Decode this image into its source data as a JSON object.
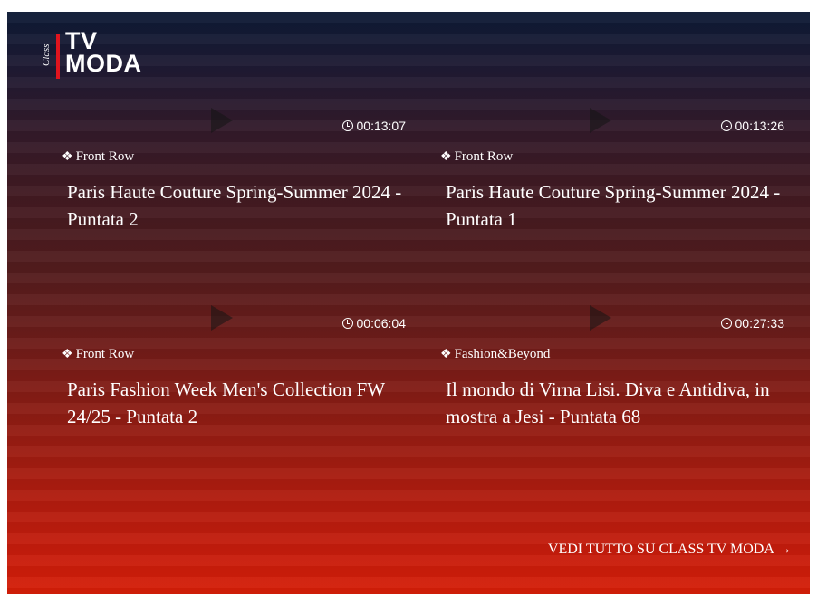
{
  "logo": {
    "class_text": "Class",
    "line1": "TV",
    "line2": "MODA"
  },
  "cards": [
    {
      "duration": "00:13:07",
      "category": "Front Row",
      "title": "Paris Haute Couture Spring-Summer 2024 - Puntata 2"
    },
    {
      "duration": "00:13:26",
      "category": "Front Row",
      "title": "Paris Haute Couture Spring-Summer 2024 - Puntata 1"
    },
    {
      "duration": "00:06:04",
      "category": "Front Row",
      "title": "Paris Fashion Week Men's Collection FW 24/25 - Puntata 2"
    },
    {
      "duration": "00:27:33",
      "category": "Fashion&Beyond",
      "title": "Il mondo di Virna Lisi. Diva e Antidiva, in mostra a Jesi - Puntata 68"
    }
  ],
  "footer": {
    "see_all": "VEDI TUTTO SU CLASS TV MODA →"
  },
  "icons": {
    "play": "play-icon",
    "clock": "clock-icon",
    "category": "diamond-icon"
  },
  "colors": {
    "top": "#0d1a35",
    "bottom": "#d51e08",
    "logo_accent": "#e0141e"
  }
}
